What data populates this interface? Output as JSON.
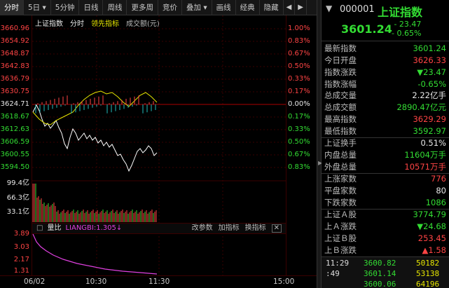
{
  "toolbar": {
    "tabs": [
      "分时",
      "5日",
      "5分钟",
      "日线",
      "周线",
      "更多周",
      "竞价",
      "叠加",
      "画线",
      "经典",
      "隐藏"
    ],
    "dropdown_tabs": [
      1,
      7
    ]
  },
  "chart": {
    "header": {
      "name": "上证指数",
      "time": "分时",
      "leading": "领先指标",
      "volume": "成交额(元)"
    },
    "price_labels": [
      "3660.96",
      "3654.92",
      "3648.87",
      "3642.83",
      "3636.79",
      "3630.75",
      "3624.71",
      "3618.67",
      "3612.63",
      "3606.59",
      "3600.55",
      "3594.50"
    ],
    "pct_labels": [
      "1.00%",
      "0.83%",
      "0.67%",
      "0.50%",
      "0.33%",
      "0.17%",
      "0.00%",
      "0.17%",
      "0.33%",
      "0.50%",
      "0.67%",
      "0.83%"
    ],
    "vol_labels": [
      "99.4亿",
      "66.3亿",
      "33.1亿"
    ],
    "sub_labels": [
      "3.89",
      "3.03",
      "2.17",
      "1.31"
    ],
    "sub_header": {
      "name": "量比",
      "value": "LIANGBI:1.305",
      "arrow": "↓"
    },
    "sub_buttons": [
      "改参数",
      "加指标",
      "换指标"
    ],
    "x_labels": [
      "06/02",
      "10:30",
      "11:30",
      "15:00"
    ],
    "colors": {
      "up": "#ff4444",
      "down": "#33dd33",
      "line": "#ffffff",
      "avg": "#e6e600",
      "liangbi": "#e040e0"
    }
  },
  "quote": {
    "code": "000001",
    "name": "上证指数",
    "price": "3601.24",
    "change": "- 23.47",
    "pct": "- 0.65%",
    "rows": [
      {
        "k": "最新指数",
        "v": "3601.24",
        "c": "grn"
      },
      {
        "k": "今日开盘",
        "v": "3626.33",
        "c": "red"
      },
      {
        "k": "指数涨跌",
        "v": "▼23.47",
        "c": "grn"
      },
      {
        "k": "指数涨幅",
        "v": "-0.65%",
        "c": "grn"
      },
      {
        "k": "总成交量",
        "v": "2.22亿手",
        "c": "wht"
      },
      {
        "k": "总成交额",
        "v": "2890.47亿元",
        "c": "grn"
      },
      {
        "k": "最高指数",
        "v": "3629.29",
        "c": "red"
      },
      {
        "k": "最低指数",
        "v": "3592.97",
        "c": "grn"
      },
      {
        "k": "上证换手",
        "v": "0.51%",
        "c": "wht"
      },
      {
        "k": "内盘总量",
        "v": "11604万手",
        "c": "grn"
      },
      {
        "k": "外盘总量",
        "v": "10571万手",
        "c": "red"
      },
      {
        "k": "上涨家数",
        "v": "776",
        "c": "red"
      },
      {
        "k": "平盘家数",
        "v": "80",
        "c": "wht"
      },
      {
        "k": "下跌家数",
        "v": "1086",
        "c": "grn"
      },
      {
        "k": "上证Ａ股",
        "v": "3774.79",
        "c": "grn"
      },
      {
        "k": "上Ａ涨跌",
        "v": "▼24.68",
        "c": "grn"
      },
      {
        "k": "上证Ｂ股",
        "v": "253.45",
        "c": "red"
      },
      {
        "k": "上Ｂ涨跌",
        "v": "▲1.58",
        "c": "red"
      }
    ],
    "ticks": [
      {
        "t": "11:29",
        "p": "3600.82",
        "v": "50182"
      },
      {
        "t": ":49",
        "p": "3601.14",
        "v": "53138"
      },
      {
        "t": "",
        "p": "3600.06",
        "v": "64196"
      }
    ]
  }
}
